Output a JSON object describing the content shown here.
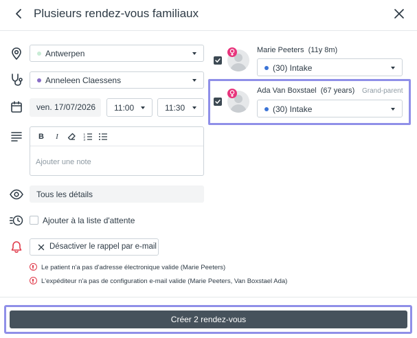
{
  "header": {
    "title": "Plusieurs rendez-vous familiaux",
    "back_icon": "chevron-left-icon",
    "close_icon": "close-icon"
  },
  "form": {
    "location": {
      "value": "Antwerpen",
      "dot_color": "#c9ecd6"
    },
    "practitioner": {
      "value": "Anneleen Claessens",
      "dot_color": "#8a6fc7"
    },
    "date": "ven. 17/07/2026",
    "start_time": "11:00",
    "end_time": "11:30",
    "note": {
      "placeholder": "Ajouter une note",
      "toolbar": [
        "B",
        "I",
        "eraser",
        "ordered-list",
        "bullet-list"
      ]
    },
    "details": "Tous les détails",
    "waitlist_label": "Ajouter à la liste d'attente",
    "reminder_button": "Désactiver le rappel par e-mail",
    "warnings": [
      "Le patient n'a pas d'adresse électronique valide (Marie Peeters)",
      "L'expéditeur n'a pas de configuration e-mail valide (Marie Peeters, Van Boxstael Ada)"
    ]
  },
  "patients": [
    {
      "name": "Marie Peeters",
      "age": "(11y 8m)",
      "role": "",
      "appointment_type": "(30) Intake",
      "checked": true
    },
    {
      "name": "Ada Van Boxstael",
      "age": "(67 years)",
      "role": "Grand-parent",
      "appointment_type": "(30) Intake",
      "checked": true
    }
  ],
  "footer": {
    "submit_label": "Créer 2 rendez-vous"
  },
  "colors": {
    "accent_dark": "#46525c",
    "highlight": "#8f8fe8",
    "alert_red": "#e03a4a",
    "gender_pink": "#e8347c",
    "type_dot": "#3b74d6"
  }
}
